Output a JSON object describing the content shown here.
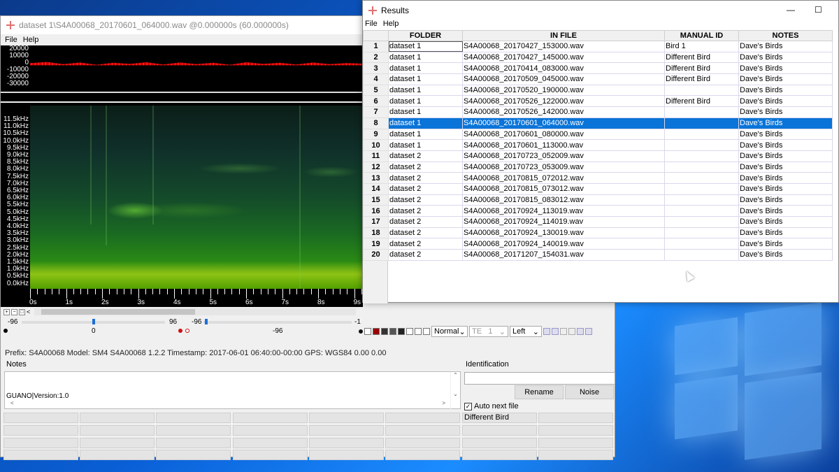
{
  "main_window": {
    "title": "dataset 1\\S4A00068_20170601_064000.wav @0.000000s (60.000000s)",
    "menu": [
      "File",
      "Help"
    ],
    "waveform_axis": [
      "20000",
      "10000",
      "0",
      "-10000",
      "-20000",
      "-30000"
    ],
    "spectrogram_axis": [
      "11.5kHz",
      "11.0kHz",
      "10.5kHz",
      "10.0kHz",
      "9.5kHz",
      "9.0kHz",
      "8.5kHz",
      "8.0kHz",
      "7.5kHz",
      "7.0kHz",
      "6.5kHz",
      "6.0kHz",
      "5.5kHz",
      "5.0kHz",
      "4.5kHz",
      "4.0kHz",
      "3.5kHz",
      "3.0kHz",
      "2.5kHz",
      "2.0kHz",
      "1.5kHz",
      "1.0kHz",
      "0.5kHz",
      "0.0kHz"
    ],
    "time_labels": [
      "0s",
      "1s",
      "2s",
      "3s",
      "4s",
      "5s",
      "6s",
      "7s",
      "8s",
      "9s"
    ],
    "sliders": {
      "left_min": "-96",
      "left_val": "0",
      "left_max": "96",
      "right_min": "-96",
      "right_val": "-96",
      "right_max": "-1"
    },
    "toolbar": {
      "mode_select": "Normal",
      "te_label": "TE",
      "te_value": "1",
      "channel_select": "Left"
    },
    "info_line": "Prefix: S4A00068  Model: SM4 S4A00068 1.2.2  Timestamp: 2017-06-01 06:40:00-00:00  GPS: WGS84 0.00 0.00",
    "notes_label": "Notes",
    "notes_text": "GUANO|Version:1.0",
    "identification_label": "Identification",
    "rename_button": "Rename",
    "noise_button": "Noise",
    "auto_next_label": "Auto next file",
    "auto_next_checked": true,
    "species_buttons": [
      "",
      "",
      "",
      "",
      "",
      "",
      "Different Bird",
      "",
      "",
      "",
      "",
      "",
      "",
      "",
      "",
      "",
      "",
      "",
      "",
      "",
      "",
      "",
      "",
      "",
      "",
      "",
      "",
      "",
      "",
      "",
      "",
      "",
      ""
    ]
  },
  "results_window": {
    "title": "Results",
    "menu": [
      "File",
      "Help"
    ],
    "columns": [
      "FOLDER",
      "IN FILE",
      "MANUAL ID",
      "NOTES"
    ],
    "selected_row": 8,
    "rows": [
      {
        "n": "1",
        "folder": "dataset 1",
        "file": "S4A00068_20170427_153000.wav",
        "id": "Bird 1",
        "notes": "Dave's Birds"
      },
      {
        "n": "2",
        "folder": "dataset 1",
        "file": "S4A00068_20170427_145000.wav",
        "id": "Different Bird",
        "notes": "Dave's Birds"
      },
      {
        "n": "3",
        "folder": "dataset 1",
        "file": "S4A00068_20170414_083000.wav",
        "id": "Different Bird",
        "notes": "Dave's Birds"
      },
      {
        "n": "4",
        "folder": "dataset 1",
        "file": "S4A00068_20170509_045000.wav",
        "id": "Different Bird",
        "notes": "Dave's Birds"
      },
      {
        "n": "5",
        "folder": "dataset 1",
        "file": "S4A00068_20170520_190000.wav",
        "id": "",
        "notes": "Dave's Birds"
      },
      {
        "n": "6",
        "folder": "dataset 1",
        "file": "S4A00068_20170526_122000.wav",
        "id": "Different Bird",
        "notes": "Dave's Birds"
      },
      {
        "n": "7",
        "folder": "dataset 1",
        "file": "S4A00068_20170526_142000.wav",
        "id": "",
        "notes": "Dave's Birds"
      },
      {
        "n": "8",
        "folder": "dataset 1",
        "file": "S4A00068_20170601_064000.wav",
        "id": "",
        "notes": "Dave's Birds"
      },
      {
        "n": "9",
        "folder": "dataset 1",
        "file": "S4A00068_20170601_080000.wav",
        "id": "",
        "notes": "Dave's Birds"
      },
      {
        "n": "10",
        "folder": "dataset 1",
        "file": "S4A00068_20170601_113000.wav",
        "id": "",
        "notes": "Dave's Birds"
      },
      {
        "n": "11",
        "folder": "dataset 2",
        "file": "S4A00068_20170723_052009.wav",
        "id": "",
        "notes": "Dave's Birds"
      },
      {
        "n": "12",
        "folder": "dataset 2",
        "file": "S4A00068_20170723_053009.wav",
        "id": "",
        "notes": "Dave's Birds"
      },
      {
        "n": "13",
        "folder": "dataset 2",
        "file": "S4A00068_20170815_072012.wav",
        "id": "",
        "notes": "Dave's Birds"
      },
      {
        "n": "14",
        "folder": "dataset 2",
        "file": "S4A00068_20170815_073012.wav",
        "id": "",
        "notes": "Dave's Birds"
      },
      {
        "n": "15",
        "folder": "dataset 2",
        "file": "S4A00068_20170815_083012.wav",
        "id": "",
        "notes": "Dave's Birds"
      },
      {
        "n": "16",
        "folder": "dataset 2",
        "file": "S4A00068_20170924_113019.wav",
        "id": "",
        "notes": "Dave's Birds"
      },
      {
        "n": "17",
        "folder": "dataset 2",
        "file": "S4A00068_20170924_114019.wav",
        "id": "",
        "notes": "Dave's Birds"
      },
      {
        "n": "18",
        "folder": "dataset 2",
        "file": "S4A00068_20170924_130019.wav",
        "id": "",
        "notes": "Dave's Birds"
      },
      {
        "n": "19",
        "folder": "dataset 2",
        "file": "S4A00068_20170924_140019.wav",
        "id": "",
        "notes": "Dave's Birds"
      },
      {
        "n": "20",
        "folder": "dataset 2",
        "file": "S4A00068_20171207_154031.wav",
        "id": "",
        "notes": "Dave's Birds"
      }
    ]
  },
  "colors": {
    "selection": "#0a74d8",
    "waveform": "#e00000",
    "app_icon": "#e07070"
  }
}
